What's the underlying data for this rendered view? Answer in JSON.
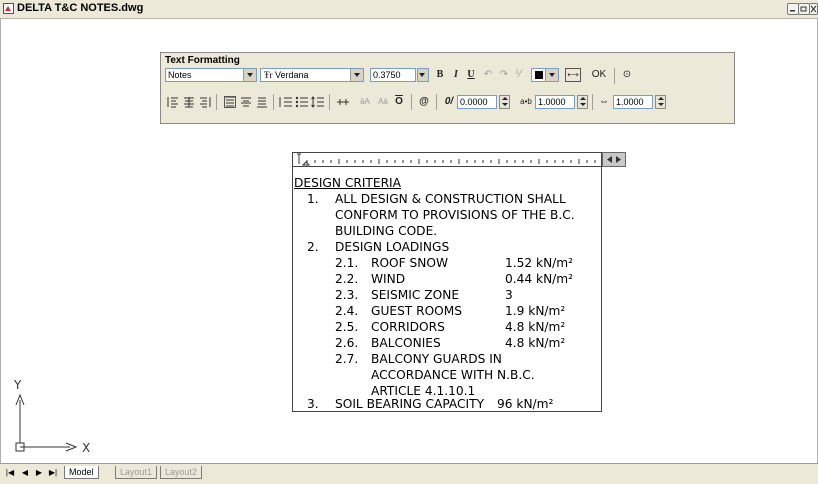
{
  "window": {
    "title": "DELTA T&C NOTES.dwg"
  },
  "text_formatting": {
    "title": "Text Formatting",
    "style": "Notes",
    "font": "Verdana",
    "height": "0.3750",
    "bold": "B",
    "italic": "I",
    "underline": "U",
    "ok_label": "OK",
    "oblique_value": "0.0000",
    "tracking_value": "1.0000",
    "width_value": "1.0000",
    "symbol_label": "@"
  },
  "mtext": {
    "heading": "DESIGN CRITERIA",
    "items": [
      {
        "num": "1.",
        "lines": [
          "ALL DESIGN & CONSTRUCTION SHALL",
          "CONFORM TO PROVISIONS OF THE B.C.",
          "BUILDING CODE."
        ]
      },
      {
        "num": "2.",
        "lines": [
          "DESIGN LOADINGS"
        ]
      },
      {
        "num": "3.",
        "lines": [
          "SOIL BEARING CAPACITY"
        ],
        "value": "96 kN/m²"
      }
    ],
    "loadings": [
      {
        "num": "2.1.",
        "label": "ROOF SNOW",
        "value": "1.52 kN/m²"
      },
      {
        "num": "2.2.",
        "label": "WIND",
        "value": "0.44 kN/m²"
      },
      {
        "num": "2.3.",
        "label": "SEISMIC ZONE",
        "value": "3"
      },
      {
        "num": "2.4.",
        "label": "GUEST ROOMS",
        "value": "1.9 kN/m²"
      },
      {
        "num": "2.5.",
        "label": "CORRIDORS",
        "value": "4.8 kN/m²"
      },
      {
        "num": "2.6.",
        "label": "BALCONIES",
        "value": "4.8 kN/m²"
      },
      {
        "num": "2.7.",
        "label": "BALCONY GUARDS IN",
        "value": ""
      }
    ],
    "loading_27_extra": [
      "ACCORDANCE WITH N.B.C.",
      "ARTICLE 4.1.10.1"
    ]
  },
  "ucs": {
    "x_label": "X",
    "y_label": "Y"
  },
  "tabs": {
    "model": "Model",
    "layout1": "Layout1",
    "layout2": "Layout2"
  }
}
